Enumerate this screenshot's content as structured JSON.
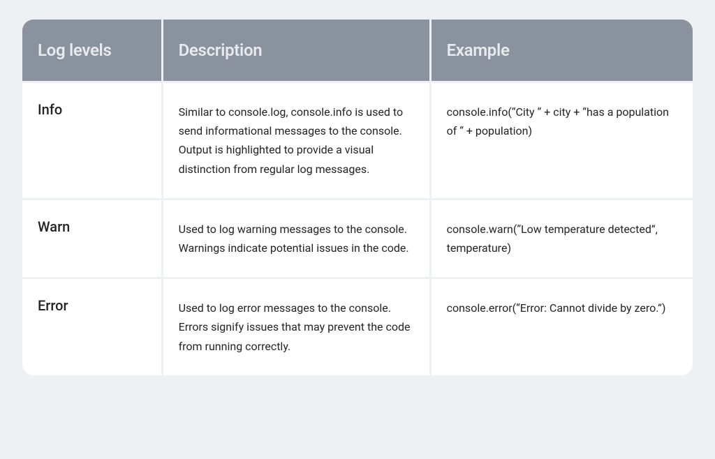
{
  "table": {
    "headers": {
      "level": "Log levels",
      "description": "Description",
      "example": "Example"
    },
    "rows": [
      {
        "level": "Info",
        "description": "Similar to console.log, console.info is used to send informational messages to the console. Output is highlighted to provide a visual distinction from regular log messages.",
        "example": "console.info(“City “ + city + “has a population of “ + population)"
      },
      {
        "level": "Warn",
        "description": "Used to log warning messages to the console. Warnings indicate potential issues in the code.",
        "example": "console.warn(“Low temperature detected”, temperature)"
      },
      {
        "level": "Error",
        "description": "Used to log error messages to the console. Errors signify issues that may prevent the code from running correctly.",
        "example": "console.error(“Error: Cannot divide by zero.”)"
      }
    ]
  }
}
